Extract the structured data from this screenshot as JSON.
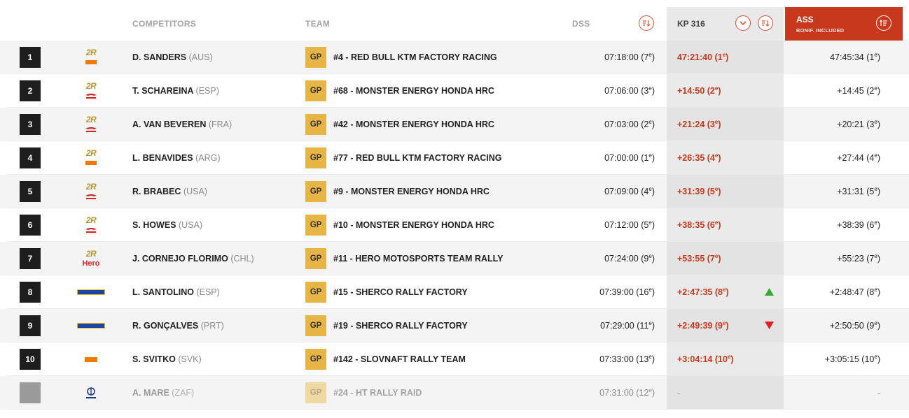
{
  "header": {
    "competitors": "COMPETITORS",
    "team": "TEAM",
    "dss": "DSS",
    "kp": "KP 316",
    "ass": "ASS",
    "ass_sub": "BONIF. INCLUDED"
  },
  "colors": {
    "accent": "#c8381d",
    "gp_badge": "#e7b545",
    "up": "#3aaa35",
    "down": "#e02020"
  },
  "rows": [
    {
      "pos": "1",
      "logo": "2r-ktm",
      "name": "D. SANDERS",
      "nat": "(AUS)",
      "gp": "GP",
      "team": "#4 - RED BULL KTM FACTORY RACING",
      "dss": "07:18:00",
      "dss_rank": "(7",
      "kp": "47:21:40",
      "kp_rank": "(1",
      "trend": "",
      "ass": "47:45:34",
      "ass_rank": "(1",
      "sup": "e",
      "close": ")"
    },
    {
      "pos": "2",
      "logo": "2r-honda",
      "name": "T. SCHAREINA",
      "nat": "(ESP)",
      "gp": "GP",
      "team": "#68 - MONSTER ENERGY HONDA HRC",
      "dss": "07:06:00",
      "dss_rank": "(3",
      "kp": "+14:50",
      "kp_rank": "(2",
      "trend": "",
      "ass": "+14:45",
      "ass_rank": "(2",
      "sup": "e",
      "close": ")"
    },
    {
      "pos": "3",
      "logo": "2r-honda",
      "name": "A. VAN BEVEREN",
      "nat": "(FRA)",
      "gp": "GP",
      "team": "#42 - MONSTER ENERGY HONDA HRC",
      "dss": "07:03:00",
      "dss_rank": "(2",
      "kp": "+21:24",
      "kp_rank": "(3",
      "trend": "",
      "ass": "+20:21",
      "ass_rank": "(3",
      "sup": "e",
      "close": ")"
    },
    {
      "pos": "4",
      "logo": "2r-ktm",
      "name": "L. BENAVIDES",
      "nat": "(ARG)",
      "gp": "GP",
      "team": "#77 - RED BULL KTM FACTORY RACING",
      "dss": "07:00:00",
      "dss_rank": "(1",
      "kp": "+26:35",
      "kp_rank": "(4",
      "trend": "",
      "ass": "+27:44",
      "ass_rank": "(4",
      "sup": "e",
      "close": ")"
    },
    {
      "pos": "5",
      "logo": "2r-honda",
      "name": "R. BRABEC",
      "nat": "(USA)",
      "gp": "GP",
      "team": "#9 - MONSTER ENERGY HONDA HRC",
      "dss": "07:09:00",
      "dss_rank": "(4",
      "kp": "+31:39",
      "kp_rank": "(5",
      "trend": "",
      "ass": "+31:31",
      "ass_rank": "(5",
      "sup": "e",
      "close": ")"
    },
    {
      "pos": "6",
      "logo": "2r-honda",
      "name": "S. HOWES",
      "nat": "(USA)",
      "gp": "GP",
      "team": "#10 - MONSTER ENERGY HONDA HRC",
      "dss": "07:12:00",
      "dss_rank": "(5",
      "kp": "+38:35",
      "kp_rank": "(6",
      "trend": "",
      "ass": "+38:39",
      "ass_rank": "(6",
      "sup": "e",
      "close": ")"
    },
    {
      "pos": "7",
      "logo": "2r-hero",
      "name": "J. CORNEJO FLORIMO",
      "nat": "(CHL)",
      "gp": "GP",
      "team": "#11 - HERO MOTOSPORTS TEAM RALLY",
      "dss": "07:24:00",
      "dss_rank": "(9",
      "kp": "+53:55",
      "kp_rank": "(7",
      "trend": "",
      "ass": "+55:23",
      "ass_rank": "(7",
      "sup": "e",
      "close": ")"
    },
    {
      "pos": "8",
      "logo": "sherco",
      "name": "L. SANTOLINO",
      "nat": "(ESP)",
      "gp": "GP",
      "team": "#15 - SHERCO RALLY FACTORY",
      "dss": "07:39:00",
      "dss_rank": "(16",
      "kp": "+2:47:35",
      "kp_rank": "(8",
      "trend": "up",
      "ass": "+2:48:47",
      "ass_rank": "(8",
      "sup": "e",
      "close": ")"
    },
    {
      "pos": "9",
      "logo": "sherco",
      "name": "R. GONÇALVES",
      "nat": "(PRT)",
      "gp": "GP",
      "team": "#19 - SHERCO RALLY FACTORY",
      "dss": "07:29:00",
      "dss_rank": "(11",
      "kp": "+2:49:39",
      "kp_rank": "(9",
      "trend": "down",
      "ass": "+2:50:50",
      "ass_rank": "(9",
      "sup": "e",
      "close": ")"
    },
    {
      "pos": "10",
      "logo": "ktm",
      "name": "S. SVITKO",
      "nat": "(SVK)",
      "gp": "GP",
      "team": "#142 - SLOVNAFT RALLY TEAM",
      "dss": "07:33:00",
      "dss_rank": "(13",
      "kp": "+3:04:14",
      "kp_rank": "(10",
      "trend": "",
      "ass": "+3:05:15",
      "ass_rank": "(10",
      "sup": "e",
      "close": ")"
    },
    {
      "pos": "",
      "logo": "husqvarna",
      "name": "A. MARE",
      "nat": "(ZAF)",
      "gp": "GP",
      "team": "#24 - HT RALLY RAID",
      "dss": "07:31:00",
      "dss_rank": "(12",
      "kp": "-",
      "kp_rank": "",
      "trend": "",
      "ass": "-",
      "ass_rank": "",
      "sup": "e",
      "close": ")",
      "inactive": true
    }
  ]
}
